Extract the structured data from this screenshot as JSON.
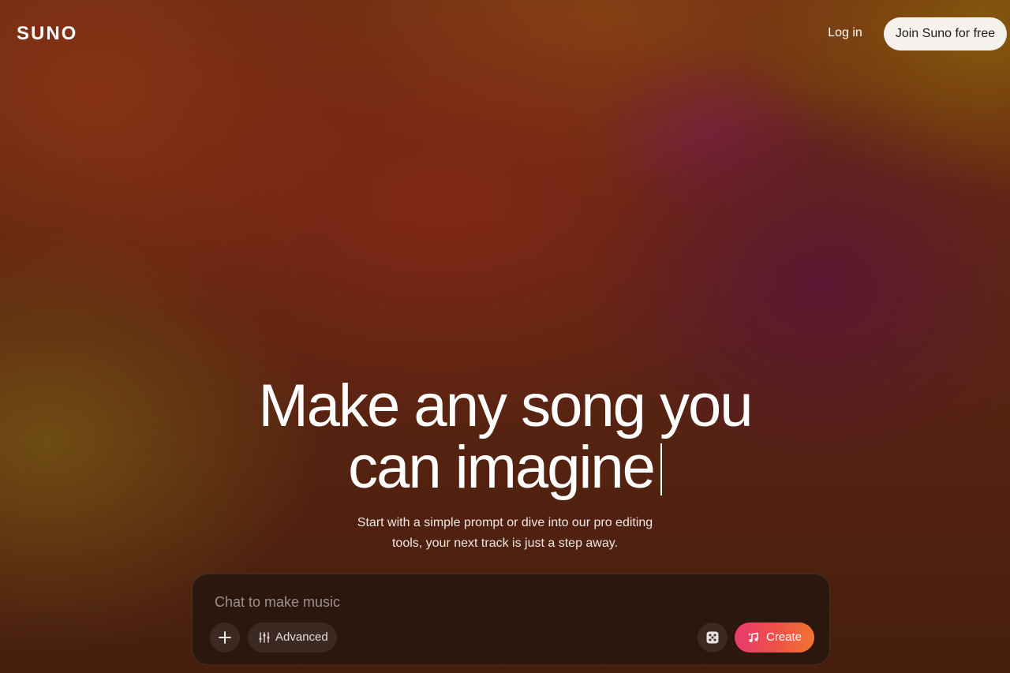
{
  "header": {
    "logo_text": "SUNO",
    "login_label": "Log in",
    "join_label": "Join Suno for free"
  },
  "hero": {
    "title_line1": "Make any song you",
    "title_line2": "can imagine",
    "subtitle_line1": "Start with a simple prompt or dive into our pro editing",
    "subtitle_line2": "tools, your next track is just a step away."
  },
  "composer": {
    "placeholder": "Chat to make music",
    "value": "",
    "add_icon": "plus-icon",
    "advanced_label": "Advanced",
    "advanced_icon": "sliders-icon",
    "dice_icon": "dice-icon",
    "create_label": "Create",
    "create_icon": "music-note-icon"
  },
  "colors": {
    "join_button_bg": "#f5f2ee",
    "create_gradient_start": "#e93a6f",
    "create_gradient_end": "#f07430",
    "text_primary": "#ffffff"
  }
}
